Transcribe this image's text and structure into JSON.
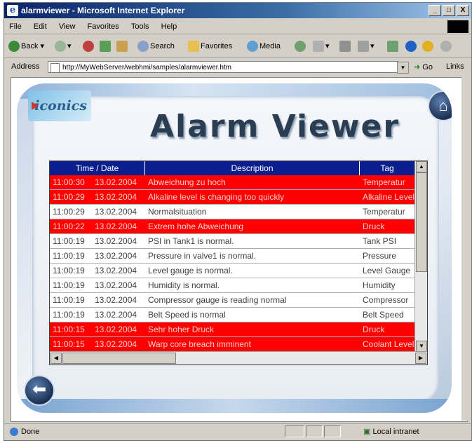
{
  "window": {
    "title": "alarmviewer - Microsoft Internet Explorer",
    "min_label": "_",
    "max_label": "□",
    "close_label": "X"
  },
  "menu": [
    "File",
    "Edit",
    "View",
    "Favorites",
    "Tools",
    "Help"
  ],
  "toolbar": {
    "back": "Back",
    "search": "Search",
    "favorites": "Favorites",
    "media": "Media"
  },
  "address": {
    "label": "Address",
    "url": "http://MyWebServer/webhmi/samples/alarmviewer.htm",
    "go": "Go",
    "links": "Links"
  },
  "page": {
    "logo": "iconics",
    "title": "Alarm Viewer"
  },
  "grid": {
    "headers": [
      "Time / Date",
      "Description",
      "Tag"
    ],
    "rows": [
      {
        "time": "11:00:30",
        "date": "13.02.2004",
        "desc": "Abweichung zu hoch",
        "tag": "Temperatur",
        "alarm": true
      },
      {
        "time": "11:00:29",
        "date": "13.02.2004",
        "desc": "Alkaline level is changing too quickly",
        "tag": "Alkaline Level",
        "alarm": true
      },
      {
        "time": "11:00:29",
        "date": "13.02.2004",
        "desc": "Normalsituation",
        "tag": "Temperatur",
        "alarm": false
      },
      {
        "time": "11:00:22",
        "date": "13.02.2004",
        "desc": "Extrem hohe Abweichung",
        "tag": "Druck",
        "alarm": true
      },
      {
        "time": "11:00:19",
        "date": "13.02.2004",
        "desc": "PSI in Tank1 is normal.",
        "tag": "Tank PSI",
        "alarm": false
      },
      {
        "time": "11:00:19",
        "date": "13.02.2004",
        "desc": "Pressure in valve1 is normal.",
        "tag": "Pressure",
        "alarm": false
      },
      {
        "time": "11:00:19",
        "date": "13.02.2004",
        "desc": "Level gauge is normal.",
        "tag": "Level Gauge",
        "alarm": false
      },
      {
        "time": "11:00:19",
        "date": "13.02.2004",
        "desc": "Humidity is normal.",
        "tag": "Humidity",
        "alarm": false
      },
      {
        "time": "11:00:19",
        "date": "13.02.2004",
        "desc": "Compressor gauge is reading normal",
        "tag": "Compressor",
        "alarm": false
      },
      {
        "time": "11:00:19",
        "date": "13.02.2004",
        "desc": "Belt Speed is normal",
        "tag": "Belt Speed",
        "alarm": false
      },
      {
        "time": "11:00:15",
        "date": "13.02.2004",
        "desc": "Sehr hoher Druck",
        "tag": "Druck",
        "alarm": true
      },
      {
        "time": "11:00:15",
        "date": "13.02.2004",
        "desc": "Warp core breach imminent",
        "tag": "Coolant Level",
        "alarm": true
      }
    ]
  },
  "status": {
    "text": "Done",
    "zone": "Local intranet"
  },
  "colors": {
    "alarm_row": "#ff0000",
    "header": "#0a1f8f"
  },
  "icons": [
    "ie-icon",
    "back-arrow-icon",
    "forward-arrow-icon",
    "stop-icon",
    "refresh-icon",
    "home-icon",
    "search-icon",
    "favorites-icon",
    "media-icon",
    "history-icon",
    "mail-icon",
    "print-icon",
    "edit-icon"
  ]
}
